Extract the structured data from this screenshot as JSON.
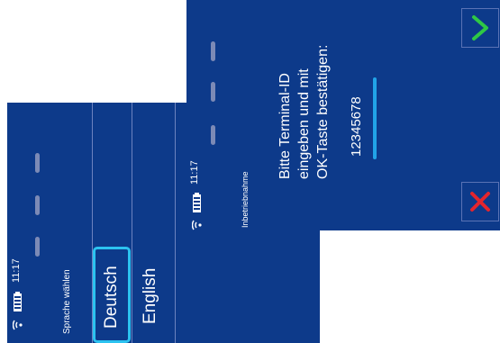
{
  "language_screen": {
    "time": "11:17",
    "title": "Sprache wählen",
    "options": [
      {
        "label": "Deutsch",
        "selected": true
      },
      {
        "label": "English",
        "selected": false
      }
    ],
    "icons": {
      "signal": "wifi-icon",
      "battery": "battery-icon"
    }
  },
  "terminal_screen": {
    "time": "11:17",
    "title": "Inbetriebnahme",
    "prompt_lines": [
      "Bitte Terminal-ID",
      "eingeben und mit",
      "OK-Taste bestätigen:"
    ],
    "terminal_id": "12345678",
    "icons": {
      "ok": "chevron-right-icon",
      "cancel": "close-icon"
    }
  },
  "colors": {
    "background": "#0d3a8a",
    "highlight": "#2cc3f0",
    "ok": "#2fc845",
    "cancel": "#e4252d"
  }
}
